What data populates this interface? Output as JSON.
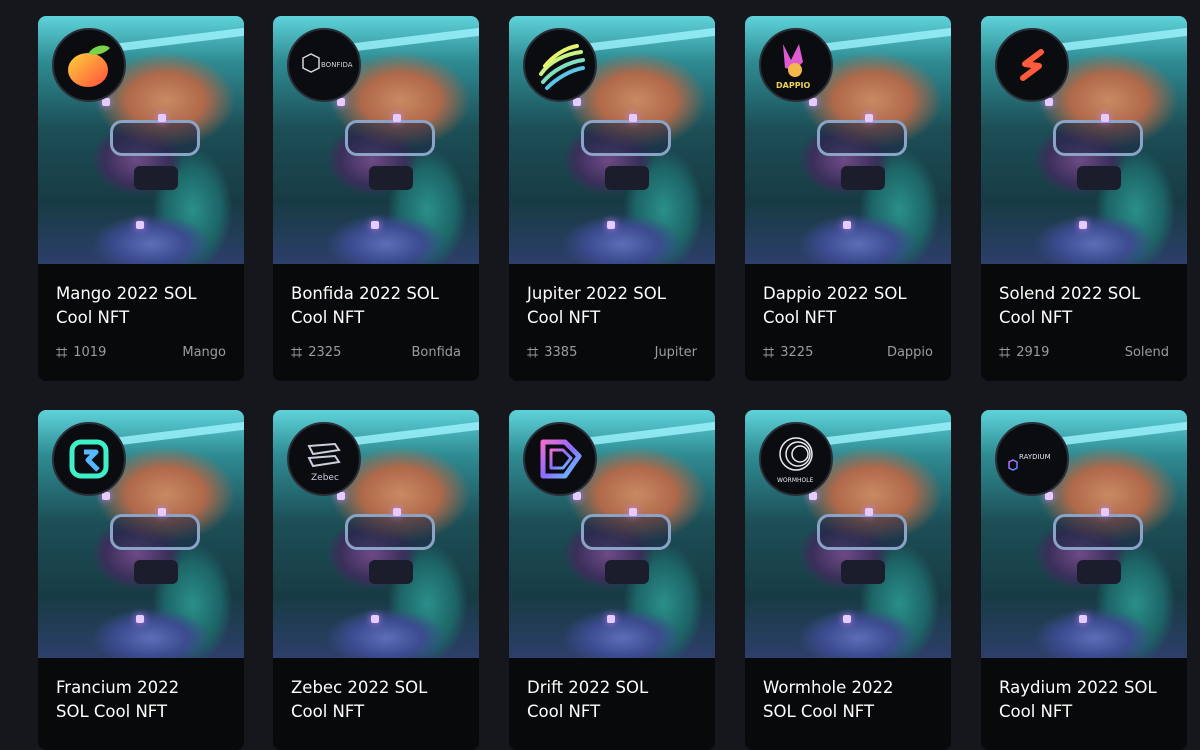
{
  "cards": [
    {
      "title": "Mango 2022 SOL Cool NFT",
      "number": "1019",
      "project": "Mango",
      "logo_icon": "mango-icon"
    },
    {
      "title": "Bonfida 2022 SOL Cool NFT",
      "number": "2325",
      "project": "Bonfida",
      "logo_icon": "bonfida-icon",
      "logo_text": "BONFIDA"
    },
    {
      "title": "Jupiter 2022 SOL Cool NFT",
      "number": "3385",
      "project": "Jupiter",
      "logo_icon": "jupiter-icon"
    },
    {
      "title": "Dappio 2022 SOL Cool NFT",
      "number": "3225",
      "project": "Dappio",
      "logo_icon": "dappio-icon",
      "logo_text": "DAPPIO"
    },
    {
      "title": "Solend 2022 SOL Cool NFT",
      "number": "2919",
      "project": "Solend",
      "logo_icon": "solend-icon"
    },
    {
      "title": "Francium 2022 SOL Cool NFT",
      "logo_icon": "francium-icon"
    },
    {
      "title": "Zebec 2022 SOL Cool NFT",
      "logo_icon": "zebec-icon",
      "logo_text": "Zebec"
    },
    {
      "title": "Drift 2022 SOL Cool NFT",
      "logo_icon": "drift-icon"
    },
    {
      "title": "Wormhole 2022 SOL Cool NFT",
      "logo_icon": "wormhole-icon",
      "logo_text": "WORMHOLE"
    },
    {
      "title": "Raydium 2022 SOL Cool NFT",
      "logo_icon": "raydium-icon",
      "logo_text": "RAYDIUM"
    }
  ],
  "icons": {
    "number": "hash-icon"
  },
  "colors": {
    "background": "#16171c",
    "card": "#08090b",
    "title": "#ffffff",
    "meta": "#9a9ca3"
  }
}
